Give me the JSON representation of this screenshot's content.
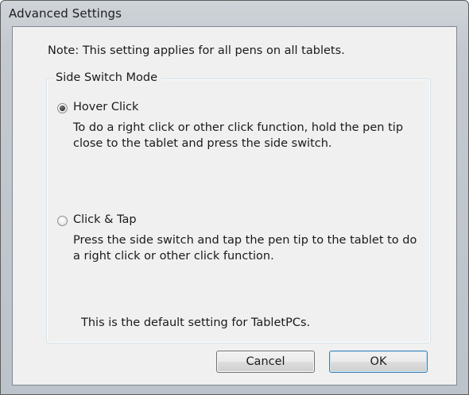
{
  "window": {
    "title": "Advanced Settings"
  },
  "note": "Note: This setting applies for all pens on all tablets.",
  "side_switch_group": {
    "legend": "Side Switch Mode",
    "options": [
      {
        "label": "Hover Click",
        "selected": true,
        "description": "To do a right click or other click function, hold the pen tip close to the tablet and press the side switch."
      },
      {
        "label": "Click & Tap",
        "selected": false,
        "description": "Press the side switch and tap the pen tip to the tablet to do a right click or other click function."
      }
    ],
    "default_note": "This is the default setting for TabletPCs."
  },
  "buttons": {
    "cancel_label": "Cancel",
    "ok_label": "OK"
  }
}
